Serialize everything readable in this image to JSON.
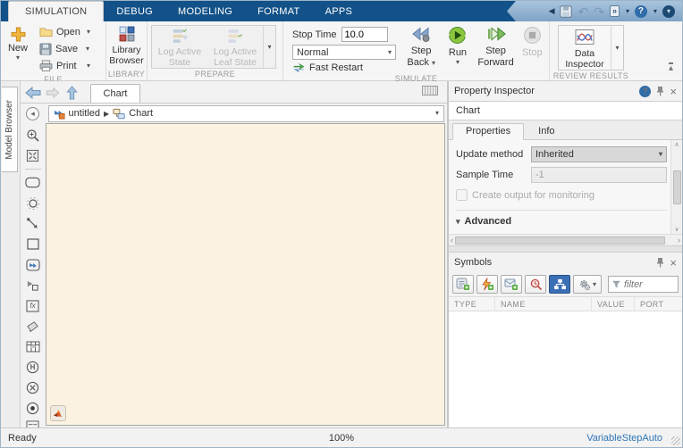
{
  "icons": {
    "caret_down": "▾",
    "caret_up": "▴",
    "chevron_left": "◀",
    "undo": "↶",
    "redo": "↷",
    "more": "»",
    "help": "?",
    "close": "×",
    "scroll_up": "∧",
    "scroll_down": "∨",
    "scroll_left": "‹",
    "scroll_right": "›",
    "breadcrumb_sep": "▶",
    "palette_collapse": "◂",
    "history_h": "H",
    "cross": "✕",
    "fx": "fx",
    "advanced_caret": "▼",
    "minimize_ribbon": "▾"
  },
  "colors": {
    "tabbar_blue": "#135288",
    "run_green": "#76BC43",
    "canvas_cream": "#FBF2E1",
    "solver_link_blue": "#2E75B6"
  },
  "tabbar": {
    "tabs": [
      {
        "label": "SIMULATION",
        "active": true
      },
      {
        "label": "DEBUG",
        "active": false
      },
      {
        "label": "MODELING",
        "active": false
      },
      {
        "label": "FORMAT",
        "active": false
      },
      {
        "label": "APPS",
        "active": false
      }
    ]
  },
  "ribbon": {
    "file": {
      "new": "New",
      "open": "Open",
      "save": "Save",
      "print": "Print",
      "section": "FILE"
    },
    "library": {
      "browser": "Library Browser",
      "section": "LIBRARY"
    },
    "prepare": {
      "log_active_state": "Log Active State",
      "log_active_leaf_state": "Log Active Leaf State",
      "section": "PREPARE"
    },
    "simulate": {
      "stop_time_label": "Stop Time",
      "stop_time_value": "10.0",
      "mode": "Normal",
      "fast_restart": "Fast Restart",
      "step_back": "Step Back",
      "run": "Run",
      "step_forward": "Step Forward",
      "stop": "Stop",
      "section": "SIMULATE"
    },
    "review": {
      "data_inspector": "Data Inspector",
      "section": "REVIEW RESULTS"
    }
  },
  "editor": {
    "model_browser": "Model Browser",
    "doc_tab": "Chart",
    "breadcrumb_model": "untitled",
    "breadcrumb_chart": "Chart"
  },
  "property_inspector": {
    "title": "Property Inspector",
    "object": "Chart",
    "tab_properties": "Properties",
    "tab_info": "Info",
    "update_method_label": "Update method",
    "update_method_value": "Inherited",
    "sample_time_label": "Sample Time",
    "sample_time_value": "-1",
    "monitor_checkbox": "Create output for monitoring",
    "advanced": "Advanced"
  },
  "symbols": {
    "title": "Symbols",
    "filter_placeholder": "filter",
    "columns": [
      "TYPE",
      "NAME",
      "VALUE",
      "PORT"
    ]
  },
  "statusbar": {
    "ready": "Ready",
    "zoom": "100%",
    "solver": "VariableStepAuto"
  }
}
